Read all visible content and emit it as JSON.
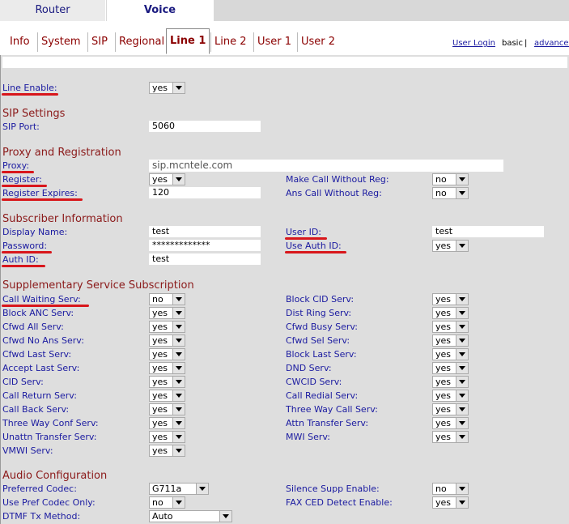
{
  "top_tabs": [
    "Router",
    "Voice"
  ],
  "sub_tabs": [
    "Info",
    "System",
    "SIP",
    "Regional",
    "Line 1",
    "Line 2",
    "User 1",
    "User 2"
  ],
  "right_links": {
    "user_login": "User Login",
    "basic": "basic",
    "sep": "|",
    "advanced": "advanced"
  },
  "line_enable": {
    "label": "Line Enable:",
    "value": "yes"
  },
  "sip_settings": {
    "title": "SIP Settings",
    "sip_port_label": "SIP Port:",
    "sip_port": "5060"
  },
  "proxy": {
    "title": "Proxy and Registration",
    "proxy_label": "Proxy:",
    "proxy_value": "sip.mcntele.com",
    "register_label": "Register:",
    "register_value": "yes",
    "make_call_label": "Make Call Without Reg:",
    "make_call_value": "no",
    "reg_expires_label": "Register Expires:",
    "reg_expires_value": "120",
    "ans_call_label": "Ans Call Without Reg:",
    "ans_call_value": "no"
  },
  "subscriber": {
    "title": "Subscriber Information",
    "display_name_label": "Display Name:",
    "display_name": "test",
    "user_id_label": "User ID:",
    "user_id": "test",
    "password_label": "Password:",
    "password": "*************",
    "use_auth_label": "Use Auth ID:",
    "use_auth": "yes",
    "auth_id_label": "Auth ID:",
    "auth_id": "test"
  },
  "supplementary": {
    "title": "Supplementary Service Subscription",
    "left": [
      {
        "label": "Call Waiting Serv:",
        "value": "no"
      },
      {
        "label": "Block ANC Serv:",
        "value": "yes"
      },
      {
        "label": "Cfwd All Serv:",
        "value": "yes"
      },
      {
        "label": "Cfwd No Ans Serv:",
        "value": "yes"
      },
      {
        "label": "Cfwd Last Serv:",
        "value": "yes"
      },
      {
        "label": "Accept Last Serv:",
        "value": "yes"
      },
      {
        "label": "CID Serv:",
        "value": "yes"
      },
      {
        "label": "Call Return Serv:",
        "value": "yes"
      },
      {
        "label": "Call Back Serv:",
        "value": "yes"
      },
      {
        "label": "Three Way Conf Serv:",
        "value": "yes"
      },
      {
        "label": "Unattn Transfer Serv:",
        "value": "yes"
      },
      {
        "label": "VMWI Serv:",
        "value": "yes"
      }
    ],
    "right": [
      {
        "label": "Block CID Serv:",
        "value": "yes"
      },
      {
        "label": "Dist Ring Serv:",
        "value": "yes"
      },
      {
        "label": "Cfwd Busy Serv:",
        "value": "yes"
      },
      {
        "label": "Cfwd Sel Serv:",
        "value": "yes"
      },
      {
        "label": "Block Last Serv:",
        "value": "yes"
      },
      {
        "label": "DND Serv:",
        "value": "yes"
      },
      {
        "label": "CWCID Serv:",
        "value": "yes"
      },
      {
        "label": "Call Redial Serv:",
        "value": "yes"
      },
      {
        "label": "Three Way Call Serv:",
        "value": "yes"
      },
      {
        "label": "Attn Transfer Serv:",
        "value": "yes"
      },
      {
        "label": "MWI Serv:",
        "value": "yes"
      }
    ]
  },
  "audio": {
    "title": "Audio Configuration",
    "pref_codec_label": "Preferred Codec:",
    "pref_codec": "G711a",
    "silence_label": "Silence Supp Enable:",
    "silence": "no",
    "use_pref_label": "Use Pref Codec Only:",
    "use_pref": "no",
    "fax_label": "FAX CED Detect Enable:",
    "fax": "yes",
    "dtmf_label": "DTMF Tx Method:",
    "dtmf": "Auto"
  },
  "colors": {
    "link": "#1a1aa0",
    "section": "#8b1a1a",
    "annotation": "#d8161b",
    "panel": "#dedede"
  }
}
